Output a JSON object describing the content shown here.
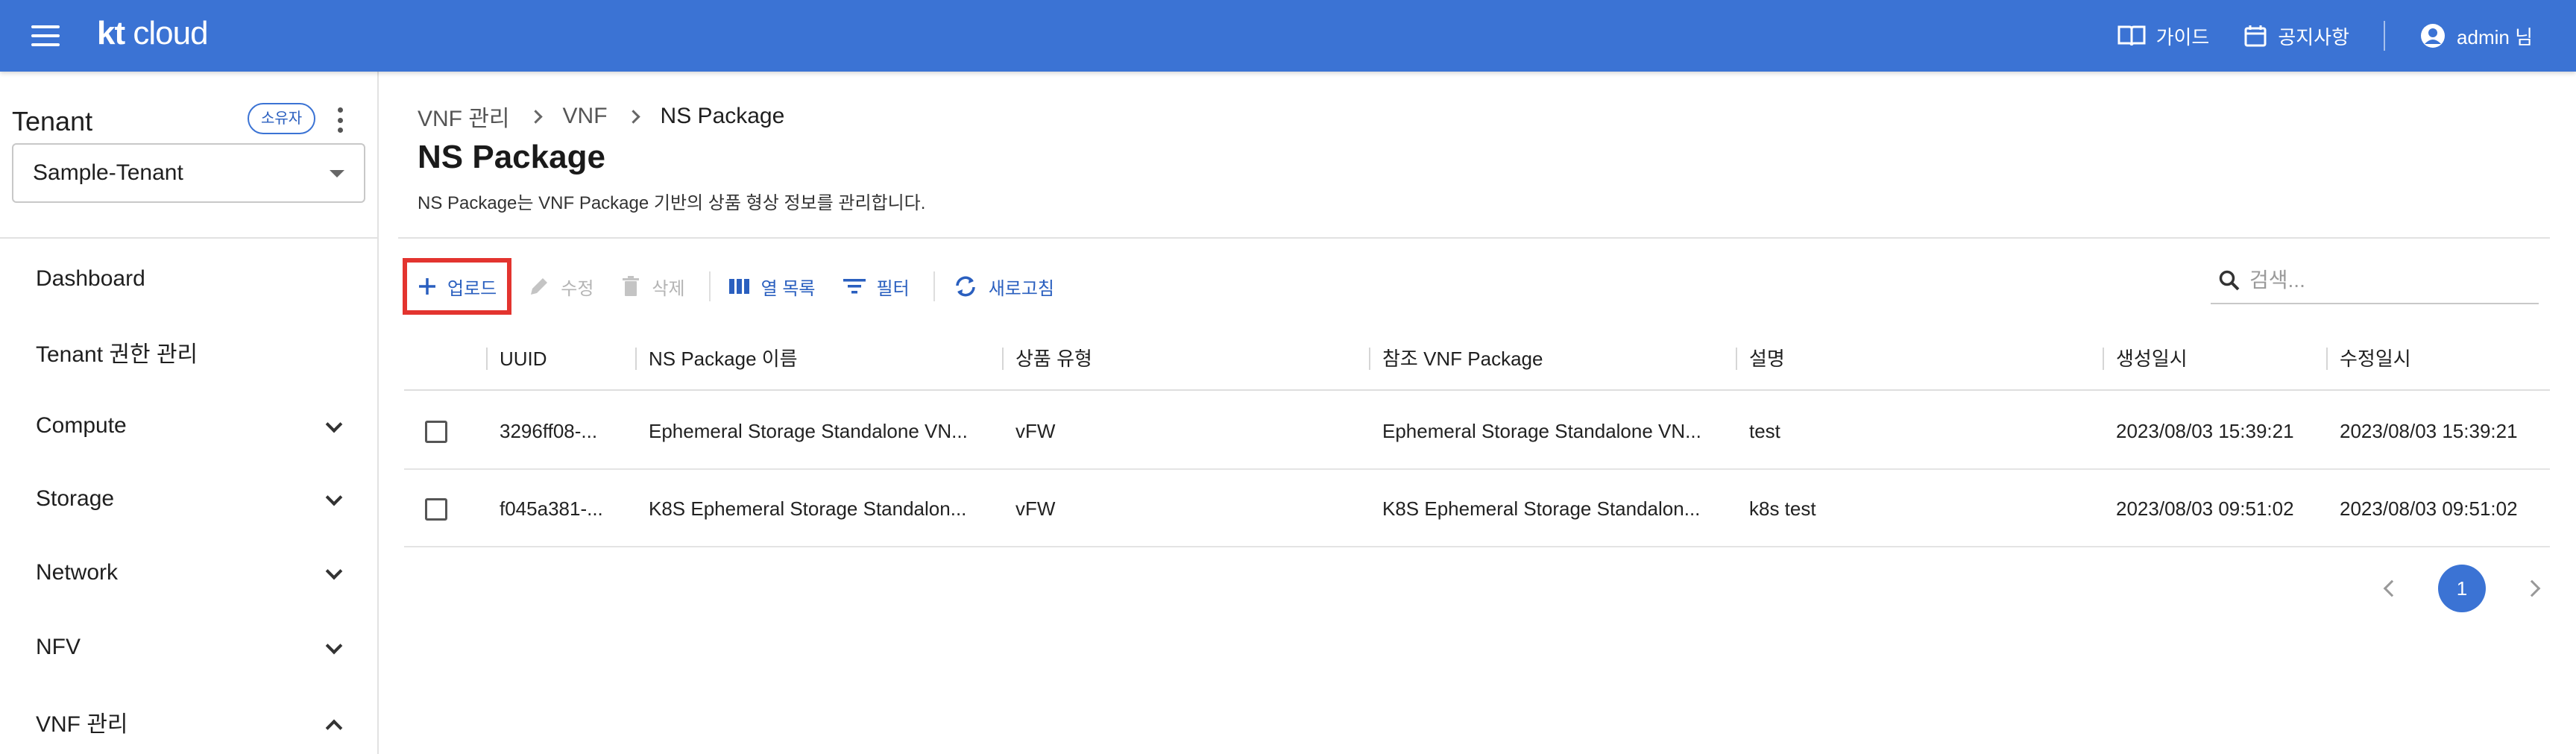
{
  "header": {
    "logo_kt": "kt",
    "logo_cloud": "cloud",
    "guide_label": "가이드",
    "notice_label": "공지사항",
    "user_label": "admin 님",
    "bg_color": "#3b73d4"
  },
  "sidebar": {
    "tenant_title": "Tenant",
    "owner_badge": "소유자",
    "tenant_selected": "Sample-Tenant",
    "items": [
      {
        "label": "Dashboard"
      },
      {
        "label": "Tenant 권한 관리"
      },
      {
        "label": "Compute"
      },
      {
        "label": "Storage"
      },
      {
        "label": "Network"
      },
      {
        "label": "NFV"
      },
      {
        "label": "VNF 관리"
      }
    ]
  },
  "main": {
    "breadcrumb": [
      "VNF 관리",
      "VNF",
      "NS Package"
    ],
    "title": "NS Package",
    "description": "NS Package는 VNF Package 기반의 상품 형상 정보를 관리합니다.",
    "toolbar": {
      "upload": "업로드",
      "edit": "수정",
      "delete": "삭제",
      "columns": "열 목록",
      "filter": "필터",
      "refresh": "새로고침"
    },
    "search_placeholder": "검색...",
    "table": {
      "columns": [
        "UUID",
        "NS Package 이름",
        "상품 유형",
        "참조 VNF Package",
        "설명",
        "생성일시",
        "수정일시"
      ],
      "rows": [
        [
          "3296ff08-...",
          "Ephemeral Storage Standalone VN...",
          "vFW",
          "Ephemeral Storage Standalone VN...",
          "test",
          "2023/08/03 15:39:21",
          "2023/08/03 15:39:21"
        ],
        [
          "f045a381-...",
          "K8S Ephemeral Storage Standalon...",
          "vFW",
          "K8S Ephemeral Storage Standalon...",
          "k8s test",
          "2023/08/03 09:51:02",
          "2023/08/03 09:51:02"
        ]
      ]
    },
    "pagination": {
      "current_page": "1"
    }
  }
}
